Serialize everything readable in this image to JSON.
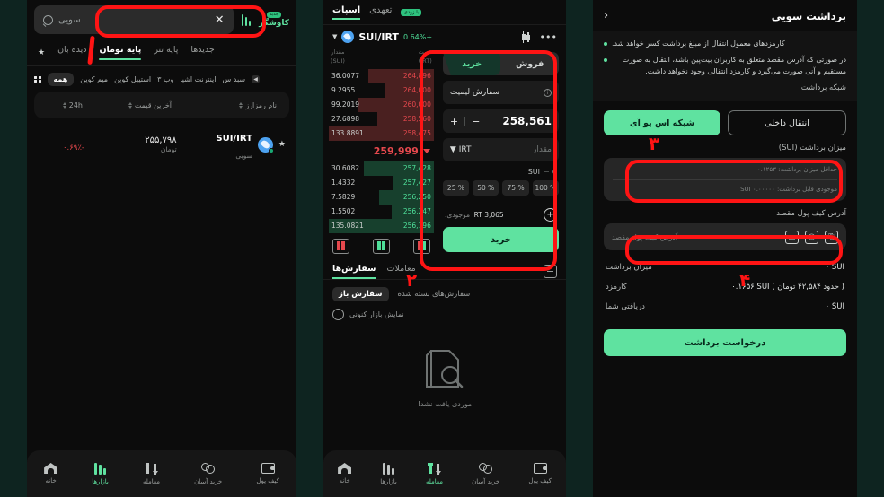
{
  "panel1": {
    "brand": {
      "name": "کاوشگر",
      "badge": "جدید"
    },
    "search": {
      "placeholder": "سویی",
      "clear": "✕",
      "icon": "search-icon"
    },
    "tabs": [
      {
        "label": "جدیدها",
        "active": false
      },
      {
        "label": "پایه تتر",
        "active": false
      },
      {
        "label": "پایه تومان",
        "active": true
      },
      {
        "label": "دیده بان",
        "active": false
      }
    ],
    "chips": [
      {
        "label": "سبد س",
        "active": false
      },
      {
        "label": "اینترنت اشیا",
        "active": false
      },
      {
        "label": "وب ۳",
        "active": false
      },
      {
        "label": "استیبل کوین",
        "active": false
      },
      {
        "label": "میم کوین",
        "active": false
      },
      {
        "label": "همه",
        "active": true
      }
    ],
    "table_headers": {
      "name": "نام رمزارز",
      "price": "آخرین قیمت",
      "change": "24h"
    },
    "rows": [
      {
        "pair": "SUI/IRT",
        "pair_sub": "سویی",
        "price": "۲۵۵,۷۹۸",
        "price_sub": "تومان",
        "change": "-۰.۶۹٪"
      }
    ]
  },
  "panel2": {
    "tabs": [
      {
        "label": "اسپات",
        "active": true
      },
      {
        "label": "تعهدی",
        "active": false
      }
    ],
    "hot_badge": "با زودی",
    "market": {
      "pair": "SUI/IRT",
      "change": "+0.64%"
    },
    "orderbook": {
      "head_amount": "مقدار",
      "head_amount_unit": "(SUI)",
      "head_price": "قیمت",
      "head_price_unit": "(IRT)",
      "asks": [
        {
          "amount": "36.0077",
          "price": "264,896",
          "depth": 62
        },
        {
          "amount": "9.2955",
          "price": "264,000",
          "depth": 47
        },
        {
          "amount": "99.2019",
          "price": "260,000",
          "depth": 72
        },
        {
          "amount": "27.6898",
          "price": "258,560",
          "depth": 54
        },
        {
          "amount": "133.8891",
          "price": "258,475",
          "depth": 100
        }
      ],
      "mid_price": "259,999",
      "bids": [
        {
          "amount": "30.6082",
          "price": "257,428",
          "depth": 67
        },
        {
          "amount": "1.4332",
          "price": "257,427",
          "depth": 38
        },
        {
          "amount": "7.5829",
          "price": "256,250",
          "depth": 52
        },
        {
          "amount": "1.5502",
          "price": "256,247",
          "depth": 40
        },
        {
          "amount": "135.0821",
          "price": "256,196",
          "depth": 100
        }
      ]
    },
    "form": {
      "buy": "خرید",
      "sell": "فروش",
      "order_type": "سفارش لیمیت",
      "price_value": "258,561",
      "minus": "−",
      "plus": "+",
      "amount_placeholder": "مقدار",
      "amount_unit": "IRT",
      "slider_unit": "SUI",
      "percents": [
        "25 %",
        "50 %",
        "75 %",
        "100 %"
      ],
      "balance_label": "موجودی:",
      "balance_value": "IRT 3,065",
      "submit": "خرید"
    },
    "orders": {
      "tabs": [
        {
          "label": "معاملات",
          "active": false
        },
        {
          "label": "سفارش‌ها",
          "active": true
        }
      ],
      "filters": [
        {
          "label": "سفارش‌های بسته شده",
          "active": false
        },
        {
          "label": "سفارش باز",
          "active": true
        }
      ],
      "toggle_label": "نمایش بازار کنونی",
      "empty_text": "موردی یافت نشد!"
    }
  },
  "panel3": {
    "title": "برداشت سویی",
    "back_icon": "chevron-left-icon",
    "notes": [
      "کارمزدهای معمول انتقال از مبلغ برداشت کسر خواهد شد.",
      "در صورتی که آدرس مقصد متعلق به کاربران بیت‌پین باشد، انتقال به صورت مستقیم و آنی صورت می‌گیرد و کارمزد انتقالی وجود نخواهد داشت."
    ],
    "network_label": "شبکه برداشت",
    "networks": [
      {
        "label": "انتقال داخلی",
        "active": false
      },
      {
        "label": "شبکه اس یو آی",
        "active": true
      }
    ],
    "amount_label": "میزان برداشت (SUI)",
    "amount_placeholder": "حداقل میزان برداشت: ۰.۱۲۵۳",
    "amount_balance": "موجودی قابل برداشت: SUI ۰.۰۰۰۰۰",
    "address_label": "آدرس کیف پول مقصد",
    "address_placeholder": "آدرس کیف پول مقصد",
    "address_icons": [
      "paste-icon",
      "contact-icon",
      "scan-icon"
    ],
    "summary": [
      {
        "key": "میزان برداشت",
        "value": "۰ SUI"
      },
      {
        "key": "کارمزد",
        "value": "۰.۱۶۵۶ SUI ( حدود ۴۲,۵۸۴ تومان )"
      },
      {
        "key": "دریافتی شما",
        "value": "۰ SUI"
      }
    ],
    "submit": "درخواست برداشت"
  },
  "bottom_nav": {
    "panel1": [
      {
        "label": "کیف پول",
        "icon": "wallet-icon",
        "active": false
      },
      {
        "label": "خرید آسان",
        "icon": "coins-icon",
        "active": false
      },
      {
        "label": "معامله",
        "icon": "trade-arrows-icon",
        "active": false
      },
      {
        "label": "بازارها",
        "icon": "chart-bars-icon",
        "active": true
      },
      {
        "label": "خانه",
        "icon": "home-icon",
        "active": false
      }
    ],
    "panel2": [
      {
        "label": "کیف پول",
        "icon": "wallet-icon",
        "active": false
      },
      {
        "label": "خرید آسان",
        "icon": "coins-icon",
        "active": false
      },
      {
        "label": "معامله",
        "icon": "trade-arrows-icon",
        "active": true
      },
      {
        "label": "بازارها",
        "icon": "chart-bars-icon",
        "active": false
      },
      {
        "label": "خانه",
        "icon": "home-icon",
        "active": false
      }
    ]
  },
  "annotations": [
    {
      "number": "۱"
    },
    {
      "number": "۲"
    },
    {
      "number": "۳"
    },
    {
      "number": "۴"
    }
  ],
  "colors": {
    "accent": "#5fe2a0",
    "up": "#4fe09a",
    "down": "#e5484d",
    "annotation": "#ff1414",
    "background": "#0e2420"
  }
}
